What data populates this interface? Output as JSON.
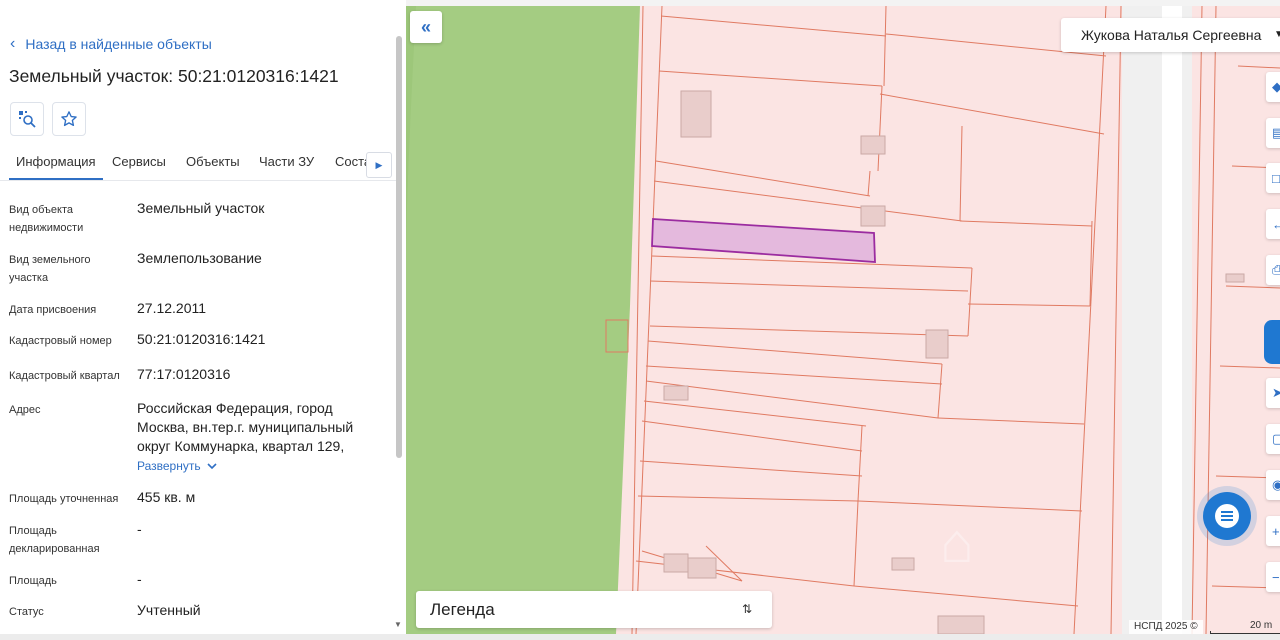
{
  "panel": {
    "back_label": "Назад в найденные объекты",
    "title": "Земельный участок: 50:21:0120316:1421",
    "tabs": [
      {
        "label": "Информация"
      },
      {
        "label": "Сервисы"
      },
      {
        "label": "Объекты"
      },
      {
        "label": "Части ЗУ"
      },
      {
        "label": "Соста"
      }
    ],
    "rows": [
      {
        "label": "Вид объекта недвижимости",
        "value": "Земельный участок"
      },
      {
        "label": "Вид земельного участка",
        "value": "Землепользование"
      },
      {
        "label": "Дата присвоения",
        "value": "27.12.2011"
      },
      {
        "label": "Кадастровый номер",
        "value": "50:21:0120316:1421"
      },
      {
        "label": "Кадастровый квартал",
        "value": "77:17:0120316"
      },
      {
        "label": "Адрес",
        "value": "Российская Федерация, город Москва, вн.тер.г. муниципальный округ Коммунарка, квартал 129,"
      },
      {
        "label": "Площадь уточненная",
        "value": "455 кв. м"
      },
      {
        "label": "Площадь декларированная",
        "value": "-"
      },
      {
        "label": "Площадь",
        "value": "-"
      },
      {
        "label": "Статус",
        "value": "Учтенный"
      }
    ],
    "expand_label": "Развернуть"
  },
  "map": {
    "user_name": "Жукова Наталья Сергеевна",
    "legend_label": "Легенда",
    "copyright": "НСПД 2025 ©",
    "scale_label": "20 m",
    "colors": {
      "parcel_fill": "#f9dcdc",
      "parcel_border": "#e07a62",
      "forest": "#a4cc82",
      "selected_fill": "#e4b9dd",
      "selected_border": "#9b2ca0",
      "accent": "#1f78d1"
    }
  }
}
